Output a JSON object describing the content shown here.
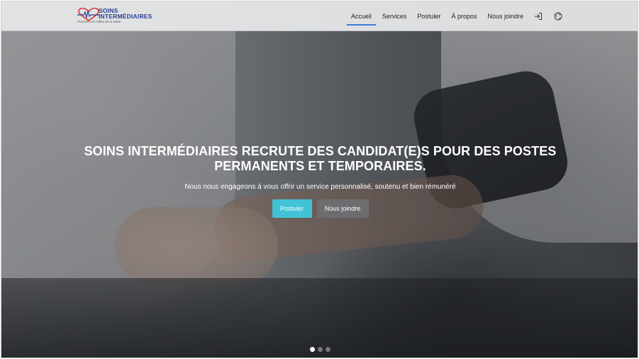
{
  "brand": {
    "name_line1": "SOINS",
    "name_line2": "INTERMÉDIAIRES",
    "tagline": "Pionniers en milieu de la santé",
    "colors": {
      "primary": "#2a3f8f",
      "heart": "#d8323a"
    }
  },
  "nav": {
    "items": [
      {
        "label": "Accueil",
        "active": true
      },
      {
        "label": "Services",
        "active": false
      },
      {
        "label": "Postuler",
        "active": false
      },
      {
        "label": "À propos",
        "active": false
      },
      {
        "label": "Nous joindre",
        "active": false
      }
    ],
    "icons": [
      "login-icon",
      "globe-icon"
    ],
    "accent": "#3a7bd5"
  },
  "hero": {
    "title": "SOINS INTERMÉDIAIRES RECRUTE DES CANDIDAT(E)S POUR DES POSTES PERMANENTS ET TEMPORAIRES.",
    "subtitle": "Nous nous engageons à vous offrir un service personnalisé, soutenu et bien rémunéré",
    "primary_button": "Postuler",
    "secondary_button": "Nous joindre",
    "colors": {
      "primary_button": "#41c2d6",
      "secondary_button": "#6e7074"
    }
  },
  "carousel": {
    "slides": 3,
    "active_index": 0
  }
}
